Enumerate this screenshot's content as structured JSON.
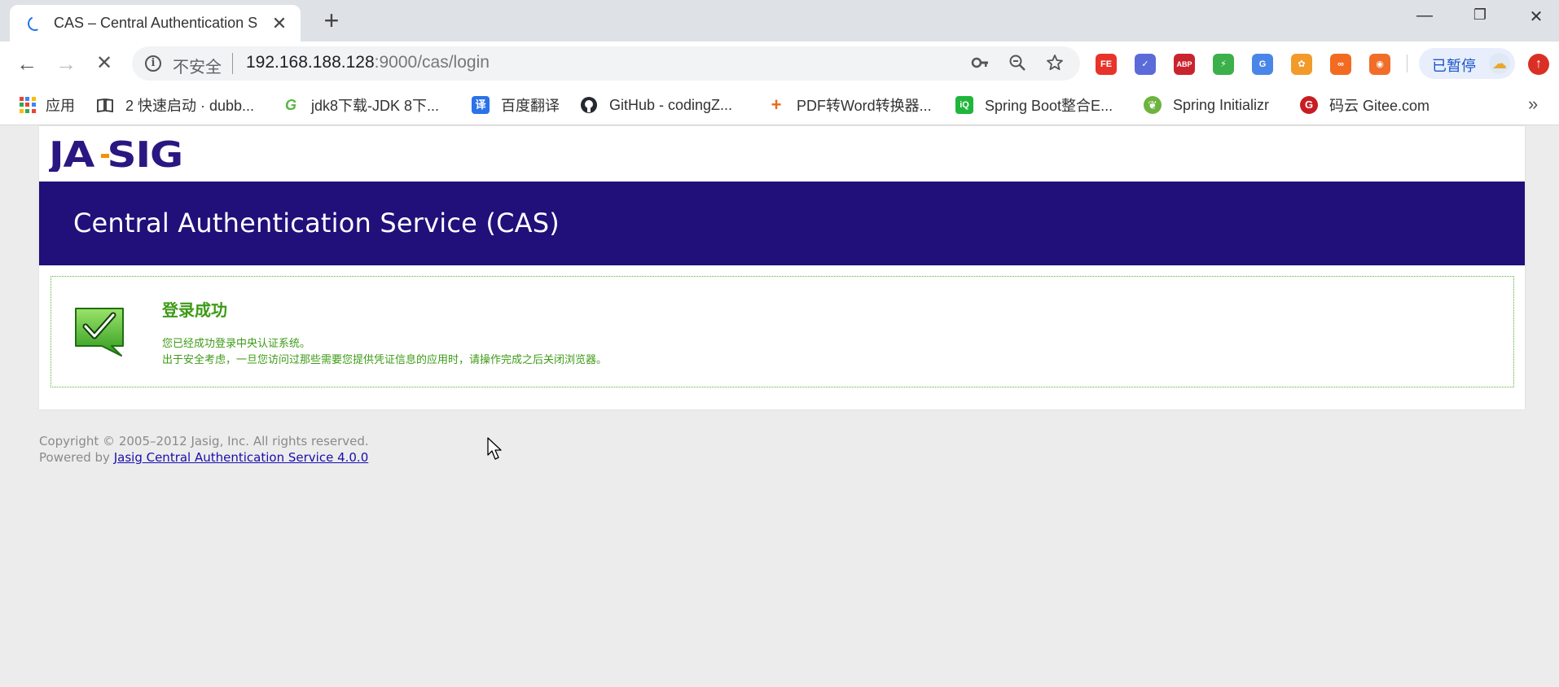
{
  "browser": {
    "tab": {
      "title": "CAS – Central Authentication S",
      "close_glyph": "✕"
    },
    "newtab_glyph": "+",
    "window_controls": {
      "minimize": "—",
      "restore": "❐",
      "close": "✕"
    },
    "nav": {
      "back": "←",
      "forward": "→",
      "stop": "✕"
    },
    "omnibox": {
      "security_label": "不安全",
      "url_host": "192.168.188.128",
      "url_rest": ":9000/cas/login",
      "key_icon": "key-icon",
      "zoom_icon": "zoom-out-icon",
      "star_icon": "star-icon"
    },
    "extensions": [
      {
        "name": "fe-extension-icon",
        "text": "FE",
        "color": "#e8332a"
      },
      {
        "name": "check-extension-icon",
        "text": "✓",
        "color": "#5b6bd8"
      },
      {
        "name": "adblock-plus-icon",
        "text": "ABP",
        "color": "#c9242e"
      },
      {
        "name": "lightning-extension-icon",
        "text": "⚡",
        "color": "#3cb04a"
      },
      {
        "name": "google-translate-icon",
        "text": "G",
        "color": "#4a86e8"
      },
      {
        "name": "flower-extension-icon",
        "text": "✿",
        "color": "#f29b2b"
      },
      {
        "name": "infinity-extension-icon",
        "text": "∞",
        "color": "#f26b21"
      },
      {
        "name": "lifebuoy-extension-icon",
        "text": "◉",
        "color": "#f06d2a"
      }
    ],
    "profile": {
      "label": "已暂停",
      "avatar_icon": "weather-avatar-icon"
    },
    "update_glyph": "↑",
    "bookmarks": [
      {
        "name": "bookmark-apps",
        "label": "应用"
      },
      {
        "name": "bookmark-dubbo",
        "label": "2 快速启动 · dubb...",
        "icon_text": "📖",
        "icon_color": "#ffffff"
      },
      {
        "name": "bookmark-jdk8",
        "label": "jdk8下载-JDK 8下...",
        "icon_text": "G",
        "icon_color": "#5bb544"
      },
      {
        "name": "bookmark-baidu-translate",
        "label": "百度翻译",
        "icon_text": "译",
        "icon_color": "#2a73e8"
      },
      {
        "name": "bookmark-github",
        "label": "GitHub - codingZ...",
        "icon_text": "●",
        "icon_color": "#24292e"
      },
      {
        "name": "bookmark-pdf-word",
        "label": "PDF转Word转换器...",
        "icon_text": "+",
        "icon_color": "#e86a1a"
      },
      {
        "name": "bookmark-spring-boot",
        "label": "Spring Boot整合E...",
        "icon_text": "iQ",
        "icon_color": "#20b63c"
      },
      {
        "name": "bookmark-spring-initializr",
        "label": "Spring Initializr",
        "icon_text": "❦",
        "icon_color": "#6db33f"
      },
      {
        "name": "bookmark-gitee",
        "label": "码云 Gitee.com",
        "icon_text": "G",
        "icon_color": "#c71d23"
      }
    ],
    "bookmarks_more": "»"
  },
  "page": {
    "logo_text": "JA-SIG",
    "banner_title": "Central Authentication Service (CAS)",
    "success": {
      "title": "登录成功",
      "line1": "您已经成功登录中央认证系统。",
      "line2": "出于安全考虑，一旦您访问过那些需要您提供凭证信息的应用时，请操作完成之后关闭浏览器。"
    },
    "footer": {
      "copyright": "Copyright © 2005–2012 Jasig, Inc. All rights reserved.",
      "powered_prefix": "Powered by ",
      "powered_link": "Jasig Central Authentication Service 4.0.0"
    }
  },
  "colors": {
    "banner": "#210f7a",
    "success_green": "#3d9b17",
    "logo_purple": "#2a1781",
    "logo_orange": "#f39200"
  }
}
